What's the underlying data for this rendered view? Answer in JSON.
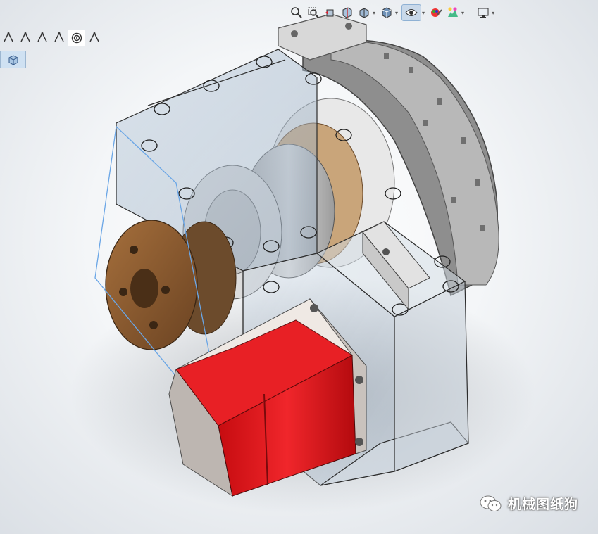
{
  "heads_up_toolbar": {
    "items": [
      {
        "icon": "zoom-to-fit-icon"
      },
      {
        "icon": "zoom-to-area-icon"
      },
      {
        "icon": "previous-view-icon"
      },
      {
        "icon": "section-view-icon"
      },
      {
        "icon": "view-orientation-icon"
      },
      {
        "icon": "display-style-icon"
      },
      {
        "icon": "hide-show-items-icon"
      },
      {
        "icon": "edit-appearance-icon"
      },
      {
        "icon": "apply-scene-icon"
      },
      {
        "icon": "view-settings-icon"
      }
    ]
  },
  "feature_toolbar": {
    "items": [
      {
        "icon": "sketch-tool-1-icon"
      },
      {
        "icon": "sketch-tool-2-icon"
      },
      {
        "icon": "sketch-tool-3-icon"
      },
      {
        "icon": "sketch-tool-4-icon"
      },
      {
        "icon": "circle-target-icon"
      },
      {
        "icon": "sketch-tool-5-icon"
      }
    ],
    "view_button_icon": "isometric-cube-icon"
  },
  "colors": {
    "motor_red": "#e8161b",
    "bronze": "#8a5a2e",
    "housing_glass": "#b4c6d8",
    "selection_blue": "#6aa6e6"
  },
  "watermark": {
    "text": "机械图纸狗",
    "icon": "wechat-logo-icon"
  }
}
